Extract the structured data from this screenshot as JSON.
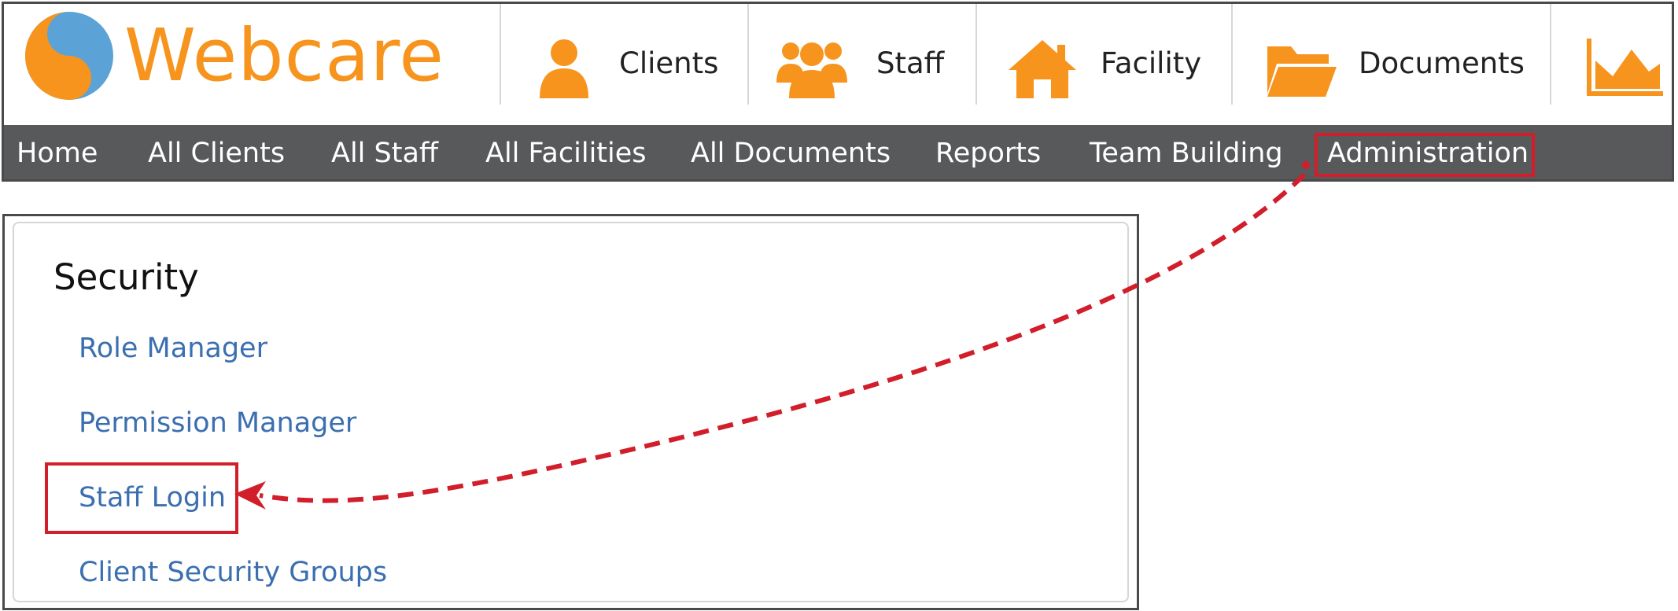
{
  "app": {
    "logo_text": "Webcare",
    "colors": {
      "brand_orange": "#f7941d",
      "brand_blue": "#5ba3d6",
      "nav_bg": "#58595b",
      "link_blue": "#3b6fb0",
      "highlight_red": "#d21e2b"
    }
  },
  "modules": [
    {
      "label": "Clients",
      "icon": "person-icon"
    },
    {
      "label": "Staff",
      "icon": "group-icon"
    },
    {
      "label": "Facility",
      "icon": "house-icon"
    },
    {
      "label": "Documents",
      "icon": "folder-icon"
    },
    {
      "label": "",
      "icon": "area-chart-icon"
    }
  ],
  "nav": {
    "items": [
      "Home",
      "All Clients",
      "All Staff",
      "All Facilities",
      "All Documents",
      "Reports",
      "Team Building",
      "Administration"
    ],
    "highlighted": "Administration"
  },
  "security": {
    "title": "Security",
    "links": [
      "Role Manager",
      "Permission Manager",
      "Staff Login",
      "Client Security Groups"
    ],
    "highlighted": "Staff Login"
  }
}
